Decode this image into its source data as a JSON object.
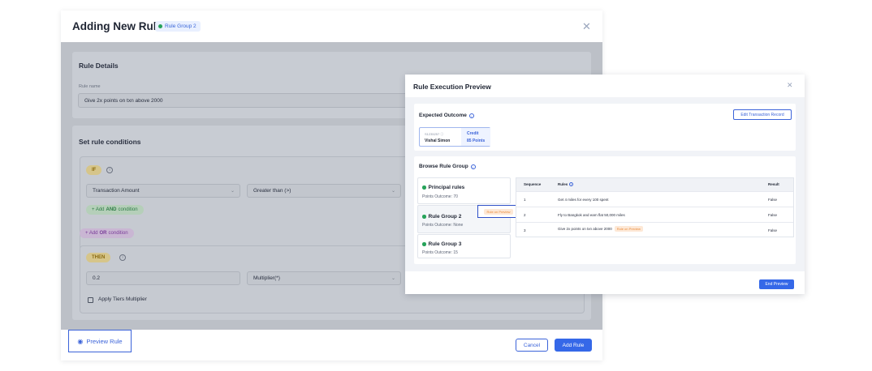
{
  "modal": {
    "title": "Adding New Rule",
    "group_chip": "Rule Group 2",
    "rule_details": {
      "title": "Rule Details",
      "name_label": "Rule name",
      "name_value": "Give 2x points on txn above 2000"
    },
    "conditions": {
      "title": "Set rule conditions",
      "if_label": "IF",
      "field_value": "Transaction Amount",
      "operator_value": "Greater than (>)",
      "add_and_prefix": "+ Add ",
      "add_and_bold": "AND",
      "add_and_suffix": " condition",
      "add_or_prefix": "+ Add ",
      "add_or_bold": "OR",
      "add_or_suffix": " condition",
      "then_label": "THEN",
      "multiplier_value": "0.2",
      "multiplier_type": "Multiplier(*)",
      "tiers_label": "Apply Tiers Multiplier"
    },
    "footer": {
      "preview_label": "Preview Rule",
      "cancel_label": "Cancel",
      "add_label": "Add Rule"
    }
  },
  "preview": {
    "title": "Rule Execution Preview",
    "expected": {
      "title": "Expected Outcome",
      "edit_label": "Edit Transaction Record",
      "record_id": "S1235257 ⓘ",
      "member_name": "Vishal Simon",
      "credit_label": "Credit",
      "points_label": "85 Points"
    },
    "browse": {
      "title": "Browse Rule Group",
      "groups": [
        {
          "name": "Principal rules",
          "outcome": "Points Outcome: 70"
        },
        {
          "name": "Rule Group 2",
          "outcome": "Points Outcome: None",
          "badge": "Role on Preview"
        },
        {
          "name": "Rule Group 3",
          "outcome": "Points Outcome: 15"
        }
      ],
      "table": {
        "headers": {
          "sequence": "Sequence",
          "rules": "Rules",
          "result": "Result"
        },
        "rows": [
          {
            "seq": "1",
            "rule": "Get 4 miles for every 100 spent",
            "result": "False"
          },
          {
            "seq": "2",
            "rule": "Fly to Bangkok and earn flat 50,000 miles",
            "result": "False"
          },
          {
            "seq": "3",
            "rule": "Give 2x points on txn above 2000",
            "badge": "Role on Preview",
            "result": "False"
          }
        ]
      }
    },
    "end_label": "End Preview"
  }
}
